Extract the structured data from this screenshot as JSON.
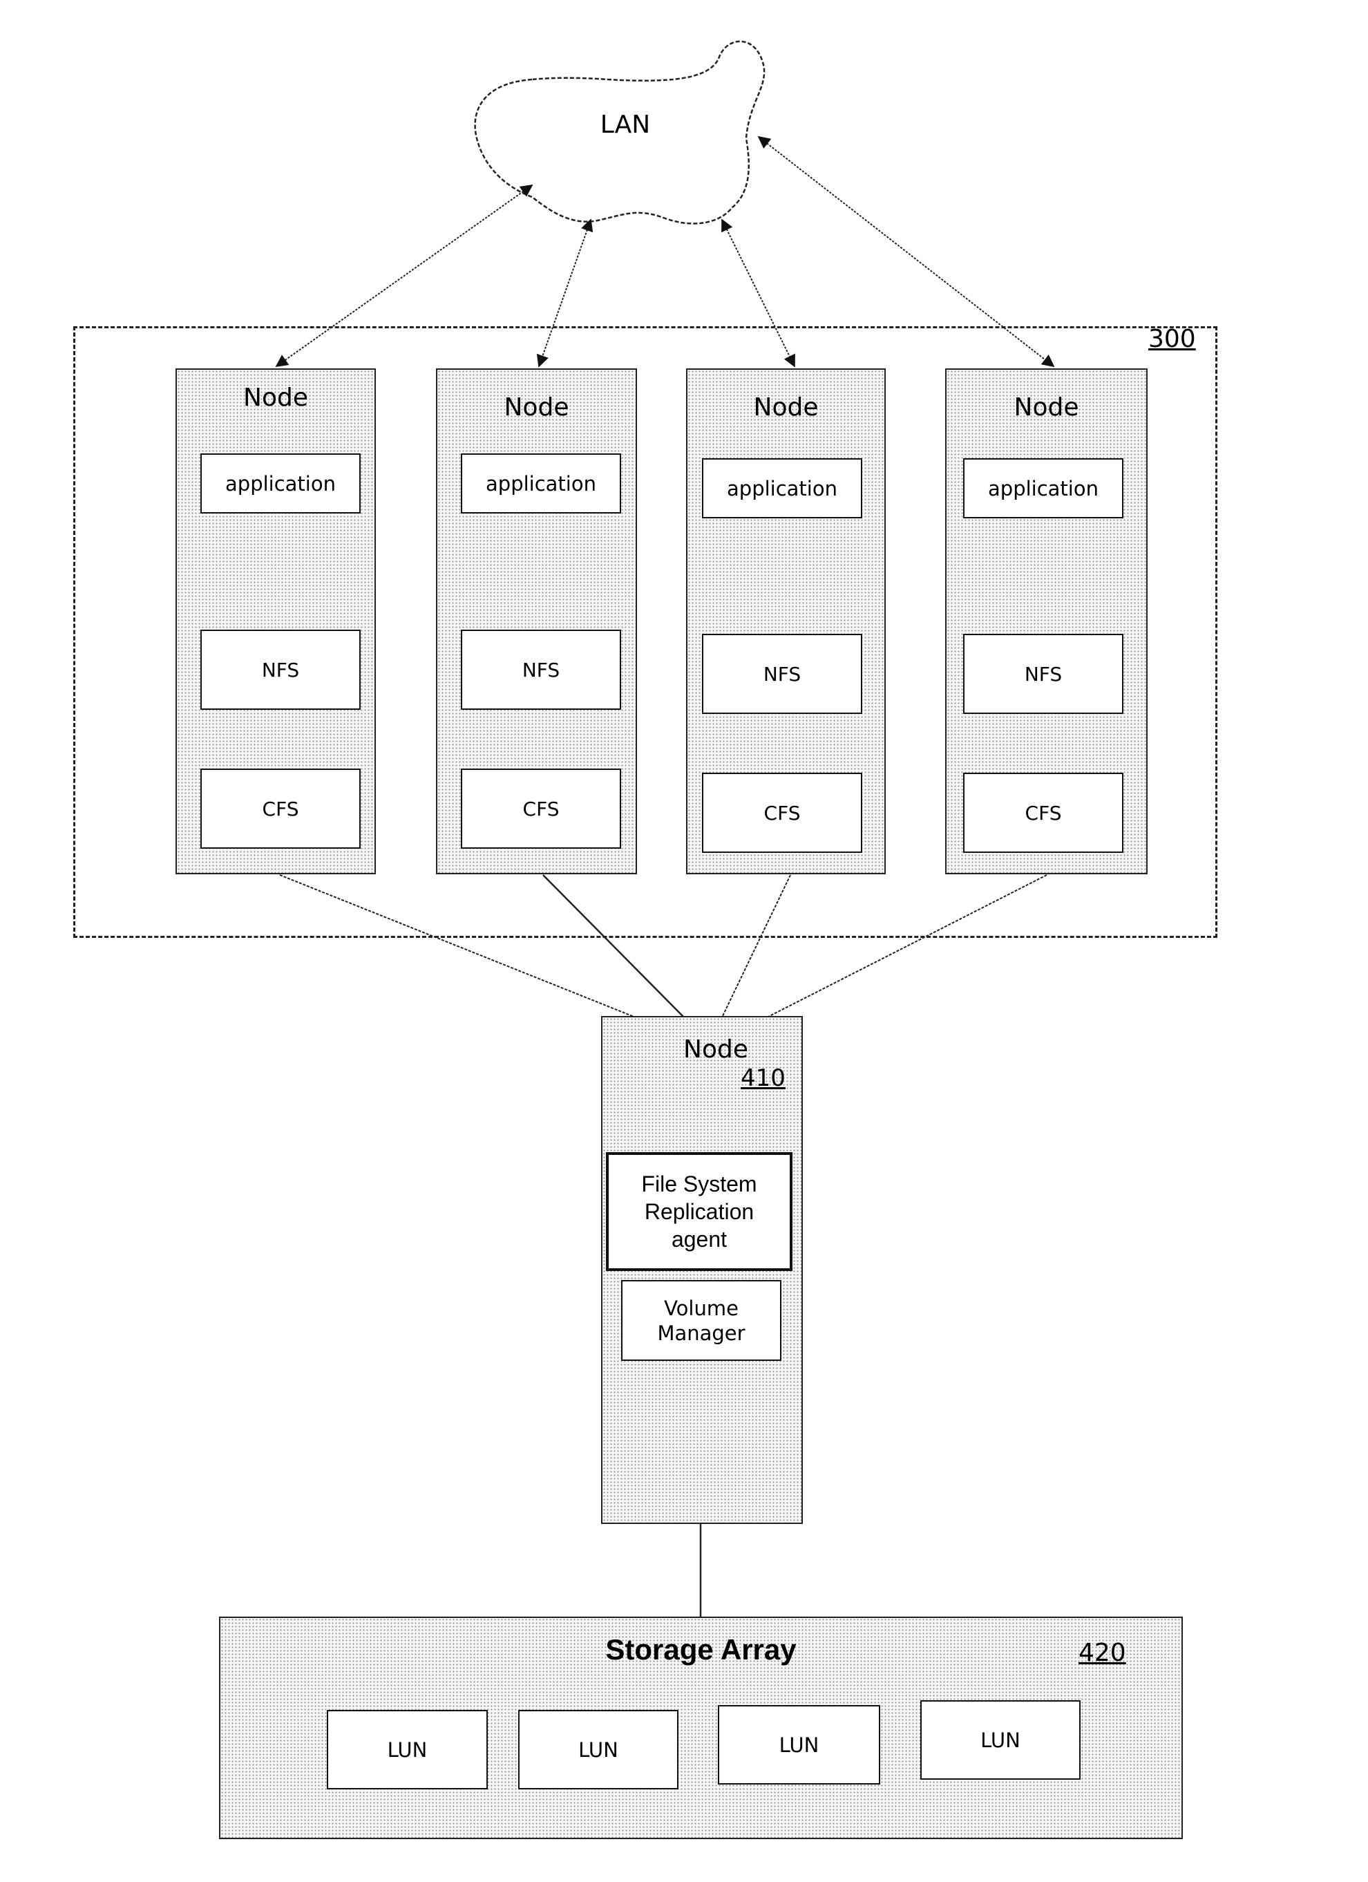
{
  "network": {
    "label": "LAN"
  },
  "cluster": {
    "ref": "300",
    "nodes": [
      {
        "title": "Node",
        "components": [
          "application",
          "NFS",
          "CFS"
        ]
      },
      {
        "title": "Node",
        "components": [
          "application",
          "NFS",
          "CFS"
        ]
      },
      {
        "title": "Node",
        "components": [
          "application",
          "NFS",
          "CFS"
        ]
      },
      {
        "title": "Node",
        "components": [
          "application",
          "NFS",
          "CFS"
        ]
      }
    ]
  },
  "replication_node": {
    "title": "Node",
    "ref": "410",
    "agent_lines": [
      "File System",
      "Replication",
      "agent"
    ],
    "volume_manager_lines": [
      "Volume",
      "Manager"
    ]
  },
  "storage": {
    "title": "Storage Array",
    "ref": "420",
    "luns": [
      "LUN",
      "LUN",
      "LUN",
      "LUN"
    ]
  }
}
